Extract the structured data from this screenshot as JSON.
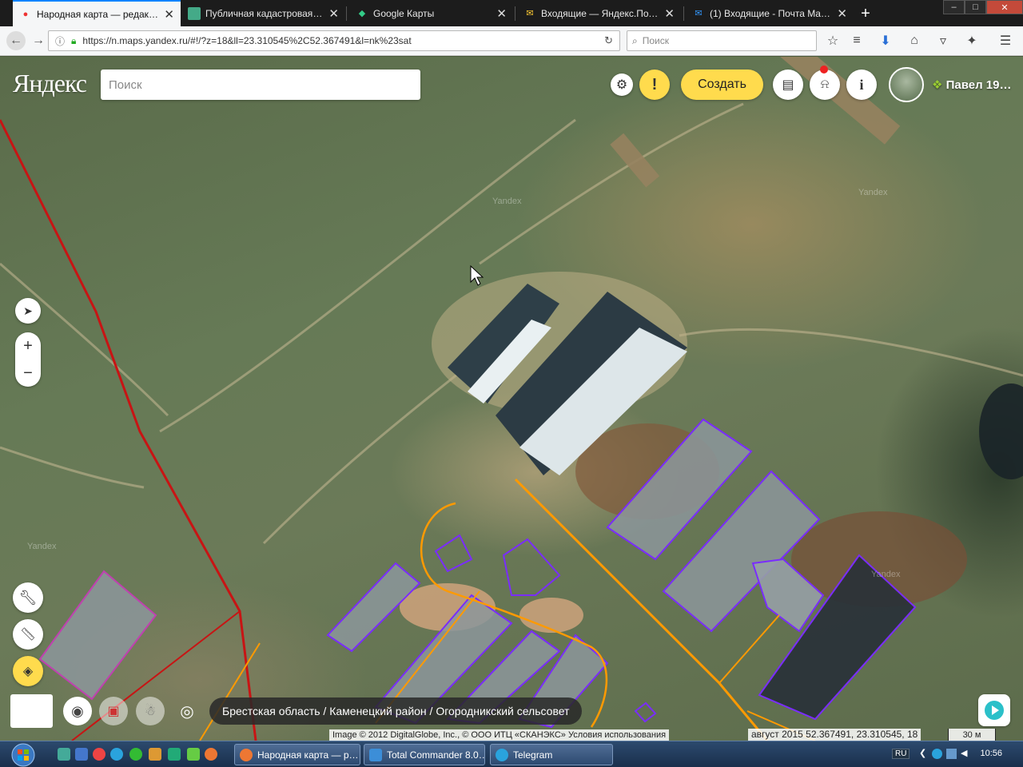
{
  "browser": {
    "tabs": [
      {
        "label": "Народная карта — редакто…",
        "active": true
      },
      {
        "label": "Публичная кадастровая ка…",
        "active": false
      },
      {
        "label": "Google Карты",
        "active": false
      },
      {
        "label": "Входящие — Яндекс.Почта",
        "active": false
      },
      {
        "label": "(1) Входящие - Почта Mail.ru",
        "active": false
      }
    ],
    "url": "https://n.maps.yandex.ru/#!/?z=18&ll=23.310545%2C52.367491&l=nk%23sat",
    "search_placeholder": "Поиск"
  },
  "header": {
    "logo": "Яндекс",
    "search_placeholder": "Поиск",
    "create_label": "Создать",
    "user_name": "Павел 19…"
  },
  "map": {
    "watermark": "Yandex",
    "breadcrumb": "Брестская область / Каменецкий район / Огородникский сельсовет",
    "copyright": "Image © 2012 DigitalGlobe, Inc., © ООО ИТЦ «СКАНЭКС»",
    "terms_link": "Условия использования",
    "date": "август 2015",
    "coords": "52.367491, 23.310545, 18",
    "scale": "30 м"
  },
  "taskbar": {
    "tasks": [
      {
        "label": "Народная карта — р…"
      },
      {
        "label": "Total Commander 8.0…"
      },
      {
        "label": "Telegram"
      }
    ],
    "lang": "RU",
    "clock": "10:56"
  },
  "colors": {
    "accent": "#ffdb4d",
    "building_outline": "#7a2cff",
    "road_main": "#c81414",
    "road_secondary": "#ff9a00"
  }
}
